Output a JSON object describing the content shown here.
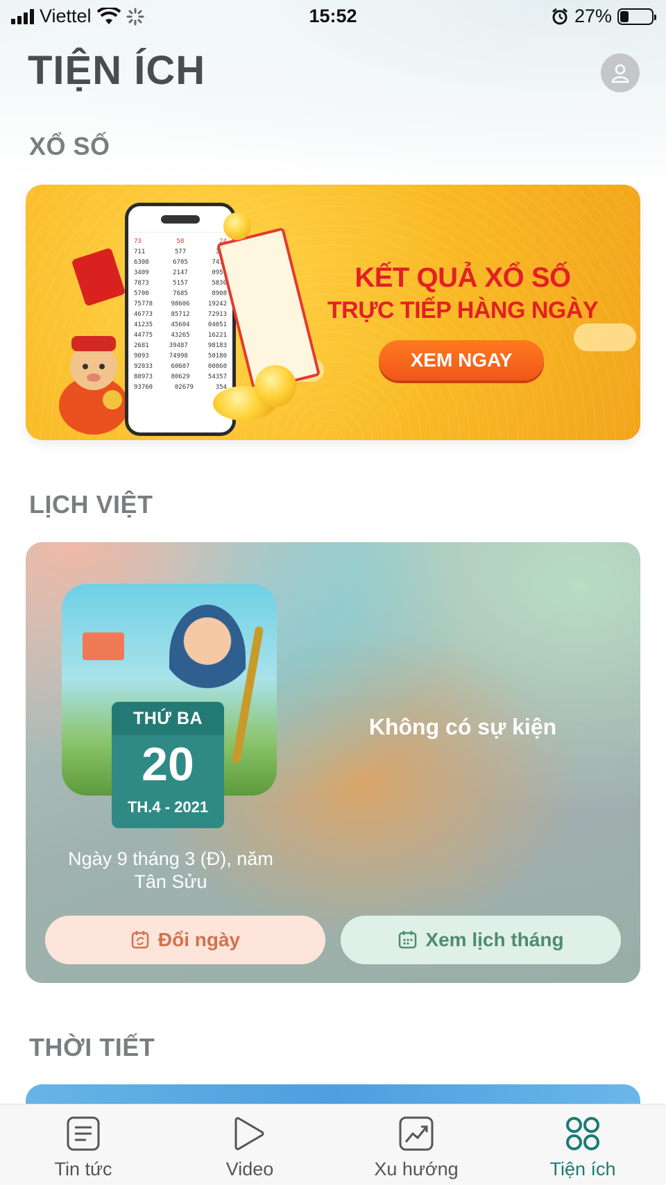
{
  "status_bar": {
    "carrier": "Viettel",
    "time": "15:52",
    "battery": "27%",
    "battery_level": 0.27
  },
  "header": {
    "title": "TIỆN ÍCH"
  },
  "sections": {
    "lottery": "XỔ SỐ",
    "calendar": "LỊCH VIỆT",
    "weather": "THỜI TIẾT"
  },
  "lottery_banner": {
    "headline": "KẾT QUẢ XỔ SỐ",
    "subline": "TRỰC TIẾP HÀNG NGÀY",
    "cta": "XEM NGAY",
    "phone_rows": [
      [
        "73",
        "58",
        "24"
      ],
      [
        "711",
        "577",
        "321"
      ],
      [
        "6308",
        "6705",
        "7415"
      ],
      [
        "3409",
        "2147",
        "0957"
      ],
      [
        "7873",
        "5157",
        "5830"
      ],
      [
        "5700",
        "7685",
        "8908"
      ],
      [
        "75778",
        "98606",
        "19242"
      ],
      [
        "46773",
        "85712",
        "72913"
      ],
      [
        "41235",
        "45604",
        "04051"
      ],
      [
        "44775",
        "43265",
        "16221"
      ],
      [
        "2681",
        "39487",
        "98183"
      ],
      [
        "9093",
        "74998",
        "50180"
      ],
      [
        "92033",
        "60607",
        "00860"
      ],
      [
        "88973",
        "80629",
        "54357"
      ],
      [
        "93760",
        "02679",
        "354"
      ]
    ]
  },
  "calendar": {
    "day_of_week": "THỨ BA",
    "day": "20",
    "month_year": "TH.4 - 2021",
    "lunar_line1": "Ngày 9 tháng 3 (Đ), năm",
    "lunar_line2": "Tân Sửu",
    "no_event": "Không có sự kiện",
    "change_date_button": "Đổi ngày",
    "month_view_button": "Xem lịch tháng"
  },
  "tab_bar": {
    "tabs": [
      {
        "label": "Tin tức",
        "icon": "news-icon"
      },
      {
        "label": "Video",
        "icon": "play-icon"
      },
      {
        "label": "Xu hướng",
        "icon": "trend-icon"
      },
      {
        "label": "Tiện ích",
        "icon": "grid-icon"
      }
    ],
    "active_index": 3,
    "active_color": "#1c7a74"
  }
}
